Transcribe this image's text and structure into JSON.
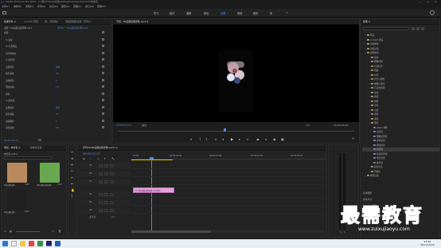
{
  "window": {
    "title": "Adobe Premiere Pro 2020 - C:\\用户\\Video\\文档\\Adobe\\Premiere Pro\\14.0\\未命名",
    "controls": [
      "—",
      "□",
      "×"
    ]
  },
  "menu": [
    "文件(F)",
    "编辑(E)",
    "剪辑(C)",
    "序列(S)",
    "标记(M)",
    "图形(G)",
    "视图(V)",
    "窗口(W)",
    "帮助(H)"
  ],
  "workspaces": [
    "学习",
    "组件",
    "编辑",
    "颜色",
    "效果",
    "音频",
    "图形",
    "库"
  ],
  "effect_controls": {
    "tabs": [
      "效果控件 ≡",
      "Lumetri 范围",
      "源：(无剪辑)",
      "音频剪辑混合器：序列01"
    ],
    "master": "主要 * 00后期后期录像.mp4",
    "clip": "序列01 * 00后期后期录像.mp4",
    "sections": [
      {
        "label": "视频",
        "header": true
      },
      {
        "label": "fx  运动"
      },
      {
        "label": "fx  不透明度"
      },
      {
        "label": "时间重映射"
      },
      {
        "label": "fx  颜色键"
      },
      {
        "label": "主要颜色",
        "value": "吸管"
      },
      {
        "label": "颜色容差",
        "value": "45"
      },
      {
        "label": "边缘细化",
        "value": "0"
      },
      {
        "label": "羽化边缘",
        "value": "0.0"
      },
      {
        "label": "蒙版"
      },
      {
        "label": "fx  颜色键"
      },
      {
        "label": "主要颜色",
        "value": "吸管"
      },
      {
        "label": "颜色容差",
        "value": "33"
      },
      {
        "label": "边缘细化",
        "value": "0"
      },
      {
        "label": "羽化边缘",
        "value": "0.0"
      }
    ],
    "timecode": "00:00:02:07"
  },
  "program": {
    "tab": "节目：00后期后期录像.mp4 ≡",
    "timecode_left": "00:00:02:07",
    "fit": "适合",
    "quality": "1/2",
    "timecode_right": "00:00:03:00"
  },
  "project": {
    "tabs": [
      "项目：未命名 ≡",
      "媒体浏览器"
    ],
    "name": "未命名.prproj",
    "items": [
      {
        "label": "00后期后期...",
        "meta": "3:00",
        "color": "#b98a5e"
      },
      {
        "label": "00后期后期录像...",
        "meta": "3:00",
        "color": "#6aa84f"
      },
      {
        "label": "00后期后期...",
        "meta": "3:00",
        "color": "#202020"
      }
    ]
  },
  "timeline": {
    "tab": "序列01(00后期后期录像.mp4) ≡",
    "timecode": "00:00:02:07",
    "ruler": [
      "00:00",
      "00:00:05:00",
      "00:00:10:00",
      "00:00:15:00",
      "00:00:20:00"
    ],
    "tracks": [
      "V3",
      "V2",
      "V1",
      "A1",
      "A2",
      "A3"
    ],
    "master": "主声道",
    "master_value": "0.0",
    "clip_label": "fx 00后期后期录像.mp4[V]"
  },
  "effects_panel": {
    "tab": "效果 ≡",
    "items": [
      {
        "label": "预设",
        "level": 0
      },
      {
        "label": "Lumetri 预设",
        "level": 0
      },
      {
        "label": "音频效果",
        "level": 0
      },
      {
        "label": "音频过渡",
        "level": 0
      },
      {
        "label": "视频效果",
        "level": 0
      },
      {
        "label": "变换",
        "level": 1
      },
      {
        "label": "图像控制",
        "level": 1
      },
      {
        "label": "实用程序",
        "level": 1
      },
      {
        "label": "扭曲",
        "level": 1
      },
      {
        "label": "时间",
        "level": 1
      },
      {
        "label": "杂色与颗粒",
        "level": 1
      },
      {
        "label": "模糊与锐化",
        "level": 1
      },
      {
        "label": "沉浸式视频",
        "level": 1
      },
      {
        "label": "生成",
        "level": 1
      },
      {
        "label": "视频",
        "level": 1
      },
      {
        "label": "调整",
        "level": 1
      },
      {
        "label": "过时",
        "level": 1
      },
      {
        "label": "过渡",
        "level": 1
      },
      {
        "label": "透视",
        "level": 1
      },
      {
        "label": "通道",
        "level": 1
      },
      {
        "label": "键控",
        "level": 1
      },
      {
        "label": "Alpha 调整",
        "level": 2
      },
      {
        "label": "亮度键",
        "level": 2
      },
      {
        "label": "图像遮罩键",
        "level": 2
      },
      {
        "label": "差值遮罩",
        "level": 2
      },
      {
        "label": "移除遮罩",
        "level": 2
      },
      {
        "label": "超级键",
        "level": 2,
        "selected": true
      },
      {
        "label": "轨道遮罩键",
        "level": 2
      },
      {
        "label": "非红色键",
        "level": 2
      },
      {
        "label": "颜色键",
        "level": 2
      },
      {
        "label": "颜色校正",
        "level": 1
      },
      {
        "label": "风格化",
        "level": 1
      },
      {
        "label": "视频过渡",
        "level": 0
      }
    ],
    "footer": [
      "基本图形",
      "基本声音",
      "Lumetri 颜色"
    ]
  },
  "watermark": {
    "text": "最需教育",
    "url": "www.zuixujiaoyu.com"
  },
  "taskbar": {
    "time": "15:56",
    "date": "2021/10/24"
  }
}
